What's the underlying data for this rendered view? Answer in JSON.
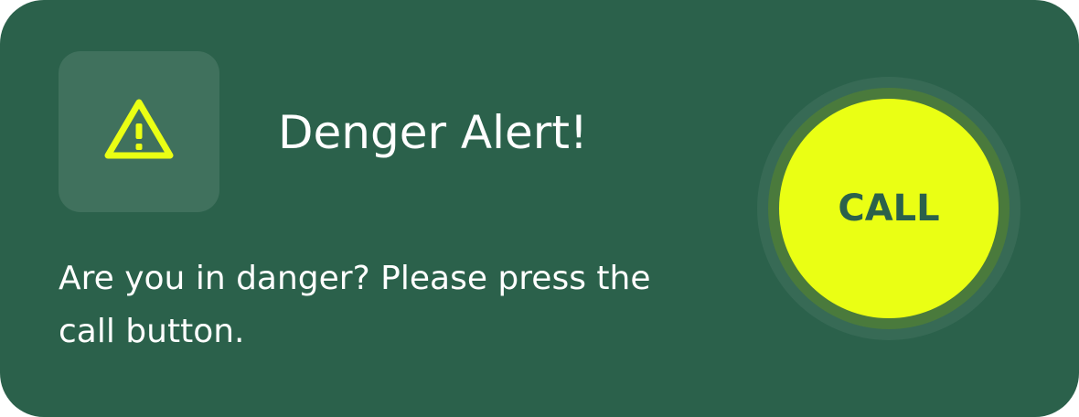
{
  "alert": {
    "icon": "warning-triangle-icon",
    "title": "Denger Alert!",
    "message": "Are you in danger? Please press the call button.",
    "call_label": "CALL"
  },
  "colors": {
    "card_background": "#2b614b",
    "accent": "#eaff14",
    "text": "#ffffff",
    "call_label_text": "#2b614b"
  }
}
